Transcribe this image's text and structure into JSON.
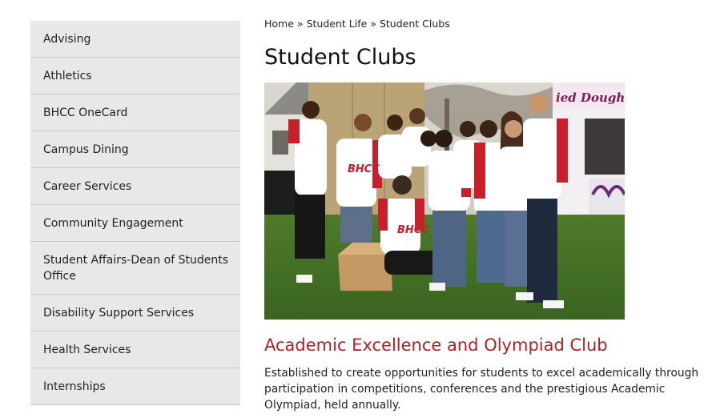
{
  "sidebar": {
    "items": [
      {
        "label": "Advising"
      },
      {
        "label": "Athletics"
      },
      {
        "label": "BHCC OneCard"
      },
      {
        "label": "Campus Dining"
      },
      {
        "label": "Career Services"
      },
      {
        "label": "Community Engagement"
      },
      {
        "label": "Student Affairs-Dean of Students Office"
      },
      {
        "label": "Disability Support Services"
      },
      {
        "label": "Health Services"
      },
      {
        "label": "Internships"
      }
    ]
  },
  "breadcrumb": {
    "home": "Home",
    "separator": "»",
    "parent": "Student Life",
    "current": "Student Clubs"
  },
  "page": {
    "title": "Student Clubs"
  },
  "photo": {
    "shirt_text": "BHCC",
    "truck_sign": "ied Dough"
  },
  "club": {
    "title": "Academic Excellence and Olympiad Club",
    "description": "Established to create opportunities for students to excel academically through participation in competitions, conferences and the prestigious Academic Olympiad, held annually."
  },
  "colors": {
    "sidebar_bg": "#e8e8e8",
    "accent_red": "#b41f24",
    "text": "#222222"
  }
}
